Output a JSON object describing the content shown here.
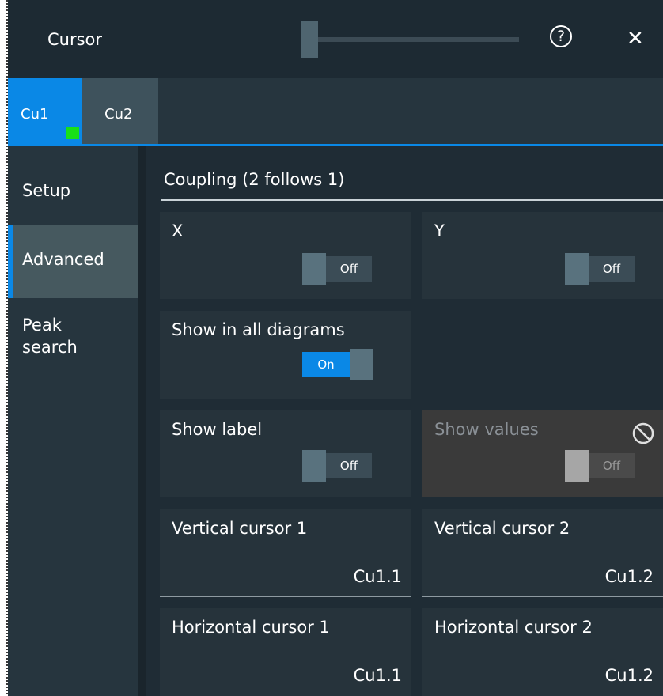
{
  "header": {
    "title": "Cursor",
    "help_icon_glyph": "?",
    "close_icon_glyph": "✕"
  },
  "tabs": [
    {
      "label": "Cu1",
      "active": true
    },
    {
      "label": "Cu2",
      "active": false
    }
  ],
  "sidebar": {
    "items": [
      {
        "label": "Setup"
      },
      {
        "label": "Advanced",
        "selected": true
      },
      {
        "label": "Peak\nsearch"
      }
    ]
  },
  "main": {
    "section_title": "Coupling (2 follows 1)",
    "x": {
      "label": "X",
      "state": "Off"
    },
    "y": {
      "label": "Y",
      "state": "Off"
    },
    "show_all": {
      "label": "Show in all diagrams",
      "state": "On"
    },
    "show_label": {
      "label": "Show label",
      "state": "Off"
    },
    "show_values": {
      "label": "Show values",
      "state": "Off",
      "disabled": true
    },
    "vertical1": {
      "label": "Vertical cursor 1",
      "value": "Cu1.1"
    },
    "vertical2": {
      "label": "Vertical cursor 2",
      "value": "Cu1.2"
    },
    "horizontal1": {
      "label": "Horizontal cursor 1",
      "value": "Cu1.1"
    },
    "horizontal2": {
      "label": "Horizontal cursor 2",
      "value": "Cu1.2"
    }
  },
  "colors": {
    "accent": "#0a88e6",
    "active_indicator": "#18e018",
    "background": "#1d2a33"
  },
  "icons": {
    "help": "help-circle-icon",
    "close": "close-icon",
    "disabled": "no-entry-icon"
  }
}
